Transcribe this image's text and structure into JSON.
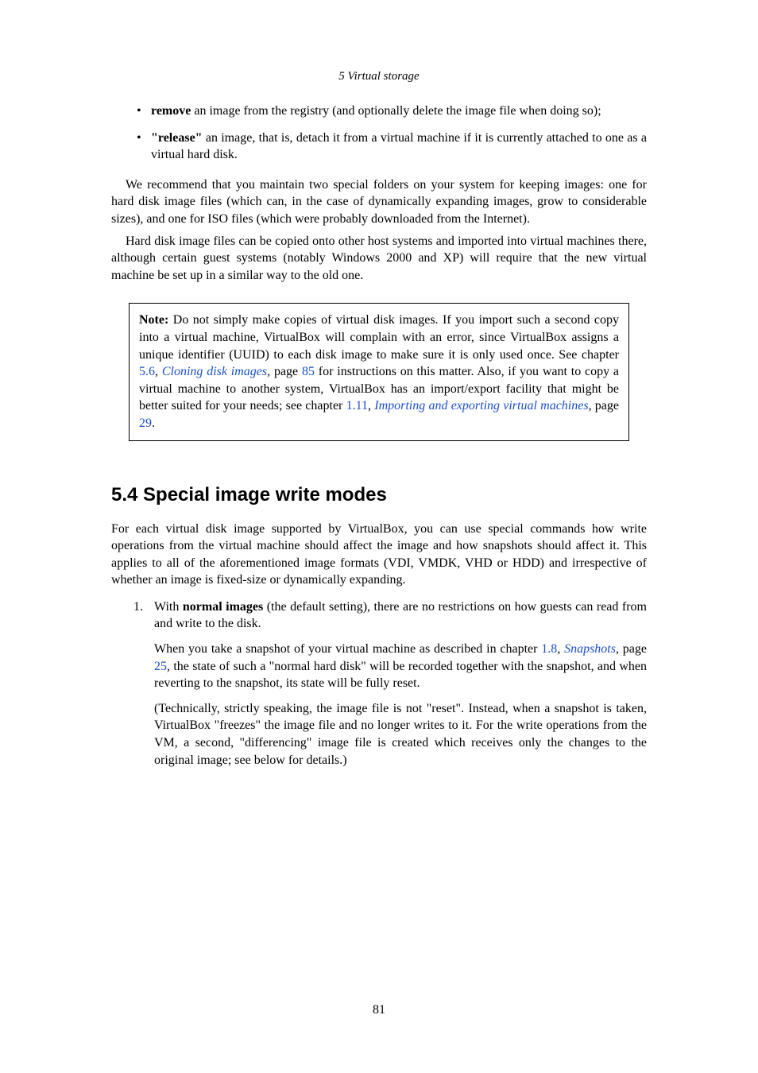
{
  "running_head": "5 Virtual storage",
  "bullets": {
    "b1_bold": "remove",
    "b1_rest": " an image from the registry (and optionally delete the image file when doing so);",
    "b2_bold": "\"release\"",
    "b2_rest": " an image, that is, detach it from a virtual machine if it is currently attached to one as a virtual hard disk."
  },
  "para1": "We recommend that you maintain two special folders on your system for keeping images: one for hard disk image files (which can, in the case of dynamically expanding images, grow to considerable sizes), and one for ISO files (which were probably downloaded from the Internet).",
  "para2": "Hard disk image files can be copied onto other host systems and imported into virtual machines there, although certain guest systems (notably Windows 2000 and XP) will require that the new virtual machine be set up in a similar way to the old one.",
  "note": {
    "label": "Note:",
    "t1": " Do not simply make copies of virtual disk images. If you import such a second copy into a virtual machine, VirtualBox will complain with an error, since VirtualBox assigns a unique identifier (UUID) to each disk image to make sure it is only used once. See chapter ",
    "l1_num": "5.6",
    "t2": ", ",
    "l1_title": "Cloning disk images",
    "t3": ", page ",
    "l1_page": "85",
    "t4": " for instructions on this matter. Also, if you want to copy a virtual machine to another system, VirtualBox has an import/export facility that might be better suited for your needs; see chapter ",
    "l2_num": "1.11",
    "t5": ", ",
    "l2_title": "Importing and exporting virtual machines",
    "t6": ", page ",
    "l2_page": "29",
    "t7": "."
  },
  "section_heading": "5.4 Special image write modes",
  "section_intro": "For each virtual disk image supported by VirtualBox, you can use special commands how write operations from the virtual machine should affect the image and how snapshots should affect it. This applies to all of the aforementioned image formats (VDI, VMDK, VHD or HDD) and irrespective of whether an image is fixed-size or dynamically expanding.",
  "item1": {
    "p1_a": "With ",
    "p1_bold": "normal images",
    "p1_b": " (the default setting), there are no restrictions on how guests can read from and write to the disk.",
    "p2_a": "When you take a snapshot of your virtual machine as described in chapter ",
    "p2_l_num": "1.8",
    "p2_b": ", ",
    "p2_l_title": "Snapshots",
    "p2_c": ", page ",
    "p2_l_page": "25",
    "p2_d": ", the state of such a \"normal hard disk\" will be recorded together with the snapshot, and when reverting to the snapshot, its state will be fully reset.",
    "p3": "(Technically, strictly speaking, the image file is not \"reset\". Instead, when a snapshot is taken, VirtualBox \"freezes\" the image file and no longer writes to it. For the write operations from the VM, a second, \"differencing\" image file is created which receives only the changes to the original image; see below for details.)"
  },
  "page_number": "81"
}
